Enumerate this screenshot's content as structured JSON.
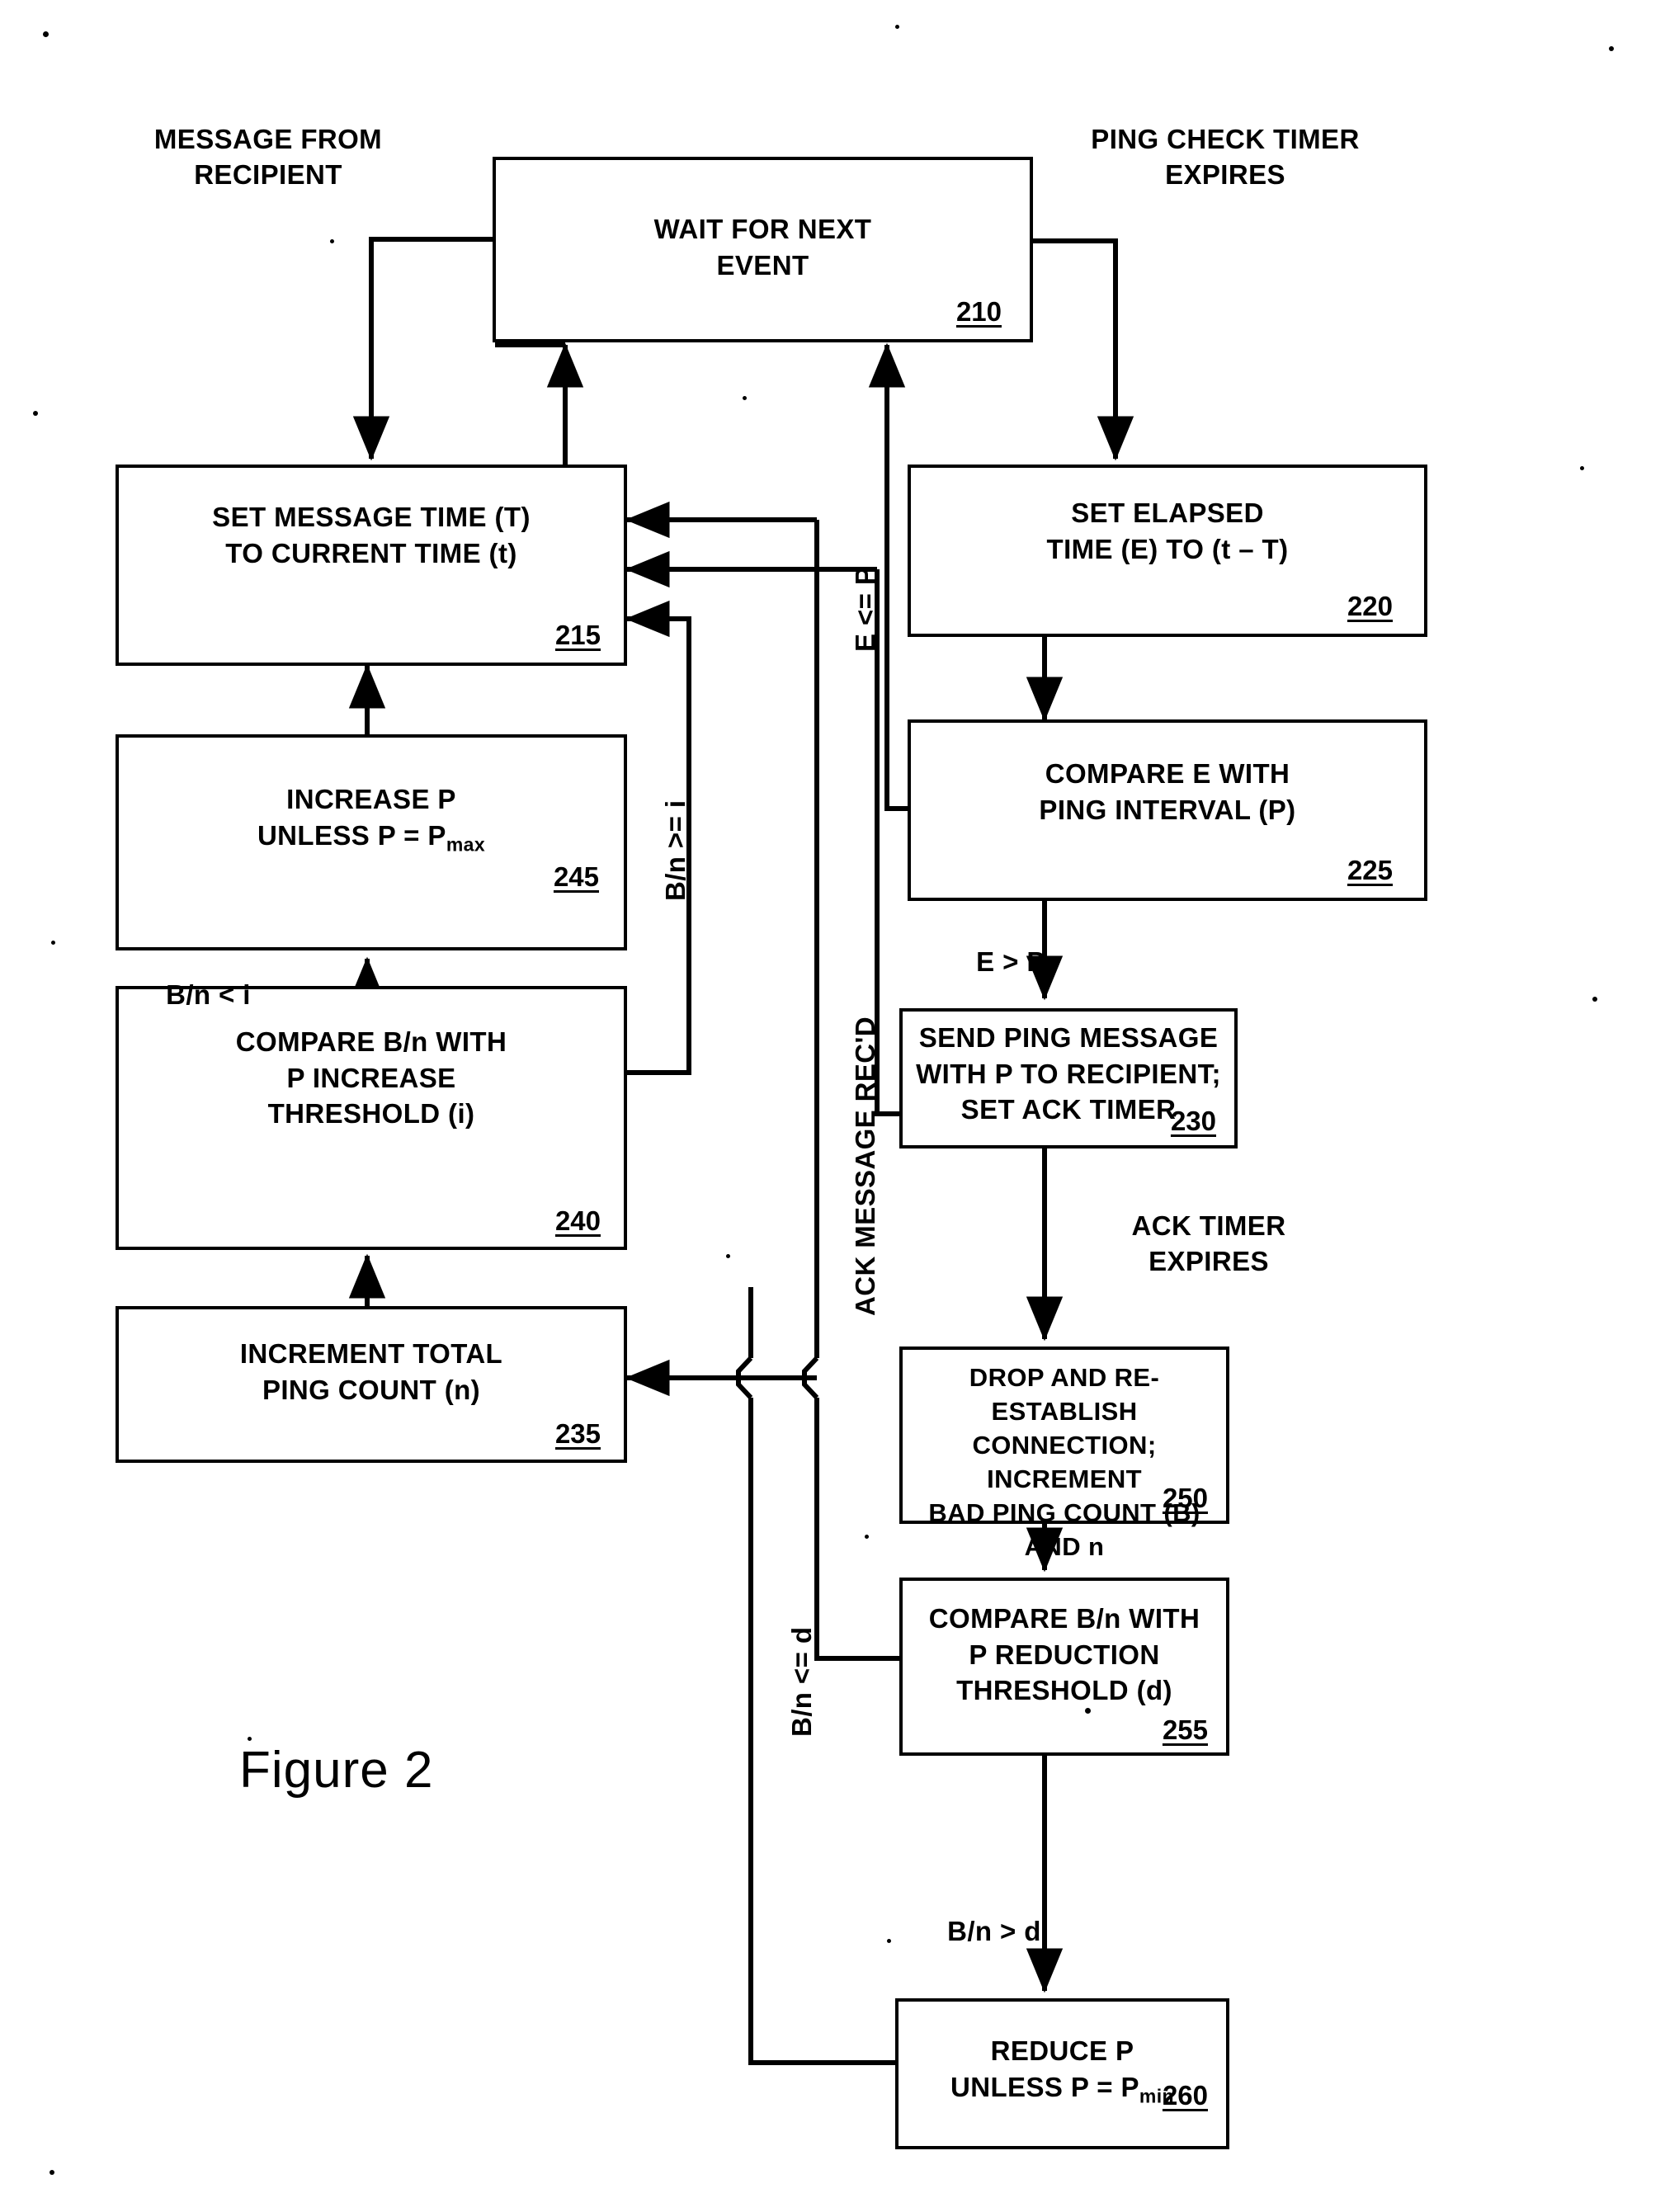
{
  "figure": {
    "caption": "Figure 2"
  },
  "boxes": [
    {
      "id": "210",
      "ref": "210",
      "lines": [
        "WAIT FOR NEXT",
        "EVENT"
      ]
    },
    {
      "id": "215",
      "ref": "215",
      "lines": [
        "SET MESSAGE TIME (T)",
        "TO CURRENT TIME (t)"
      ]
    },
    {
      "id": "220",
      "ref": "220",
      "lines": [
        "SET ELAPSED",
        "TIME (E) TO (t – T)"
      ]
    },
    {
      "id": "225",
      "ref": "225",
      "lines": [
        "COMPARE E WITH",
        "PING INTERVAL (P)"
      ]
    },
    {
      "id": "230",
      "ref": "230",
      "lines": [
        "SEND PING MESSAGE",
        "WITH P TO RECIPIENT;",
        "SET ACK TIMER"
      ]
    },
    {
      "id": "235",
      "ref": "235",
      "lines": [
        "INCREMENT TOTAL",
        "PING COUNT (n)"
      ]
    },
    {
      "id": "240",
      "ref": "240",
      "lines": [
        "COMPARE B/n WITH",
        "P INCREASE",
        "THRESHOLD (i)"
      ]
    },
    {
      "id": "245",
      "ref": "245",
      "lines": [
        "INCREASE P",
        "UNLESS P = P"
      ],
      "subscript": "max"
    },
    {
      "id": "250",
      "ref": "250",
      "lines": [
        "DROP AND RE-ESTABLISH",
        "CONNECTION; INCREMENT",
        "BAD PING COUNT (B)",
        "AND n"
      ]
    },
    {
      "id": "255",
      "ref": "255",
      "lines": [
        "COMPARE B/n WITH",
        "P REDUCTION",
        "THRESHOLD (d)"
      ]
    },
    {
      "id": "260",
      "ref": "260",
      "lines": [
        "REDUCE P",
        "UNLESS P = P"
      ],
      "subscript": "min"
    }
  ],
  "edge_labels": {
    "message_from_recipient": "MESSAGE FROM\nRECIPIENT",
    "ping_check_timer_expires": "PING CHECK TIMER\nEXPIRES",
    "e_le_p": "E <= P",
    "e_gt_p": "E > P",
    "ack_timer_expires": "ACK TIMER\nEXPIRES",
    "ack_message_recd": "ACK MESSAGE REC'D",
    "bn_ge_i": "B/n >= i",
    "bn_lt_i": "B/n < i",
    "bn_le_d": "B/n <= d",
    "bn_gt_d": "B/n > d"
  },
  "colors": {
    "ink": "#000000",
    "paper": "#ffffff"
  }
}
